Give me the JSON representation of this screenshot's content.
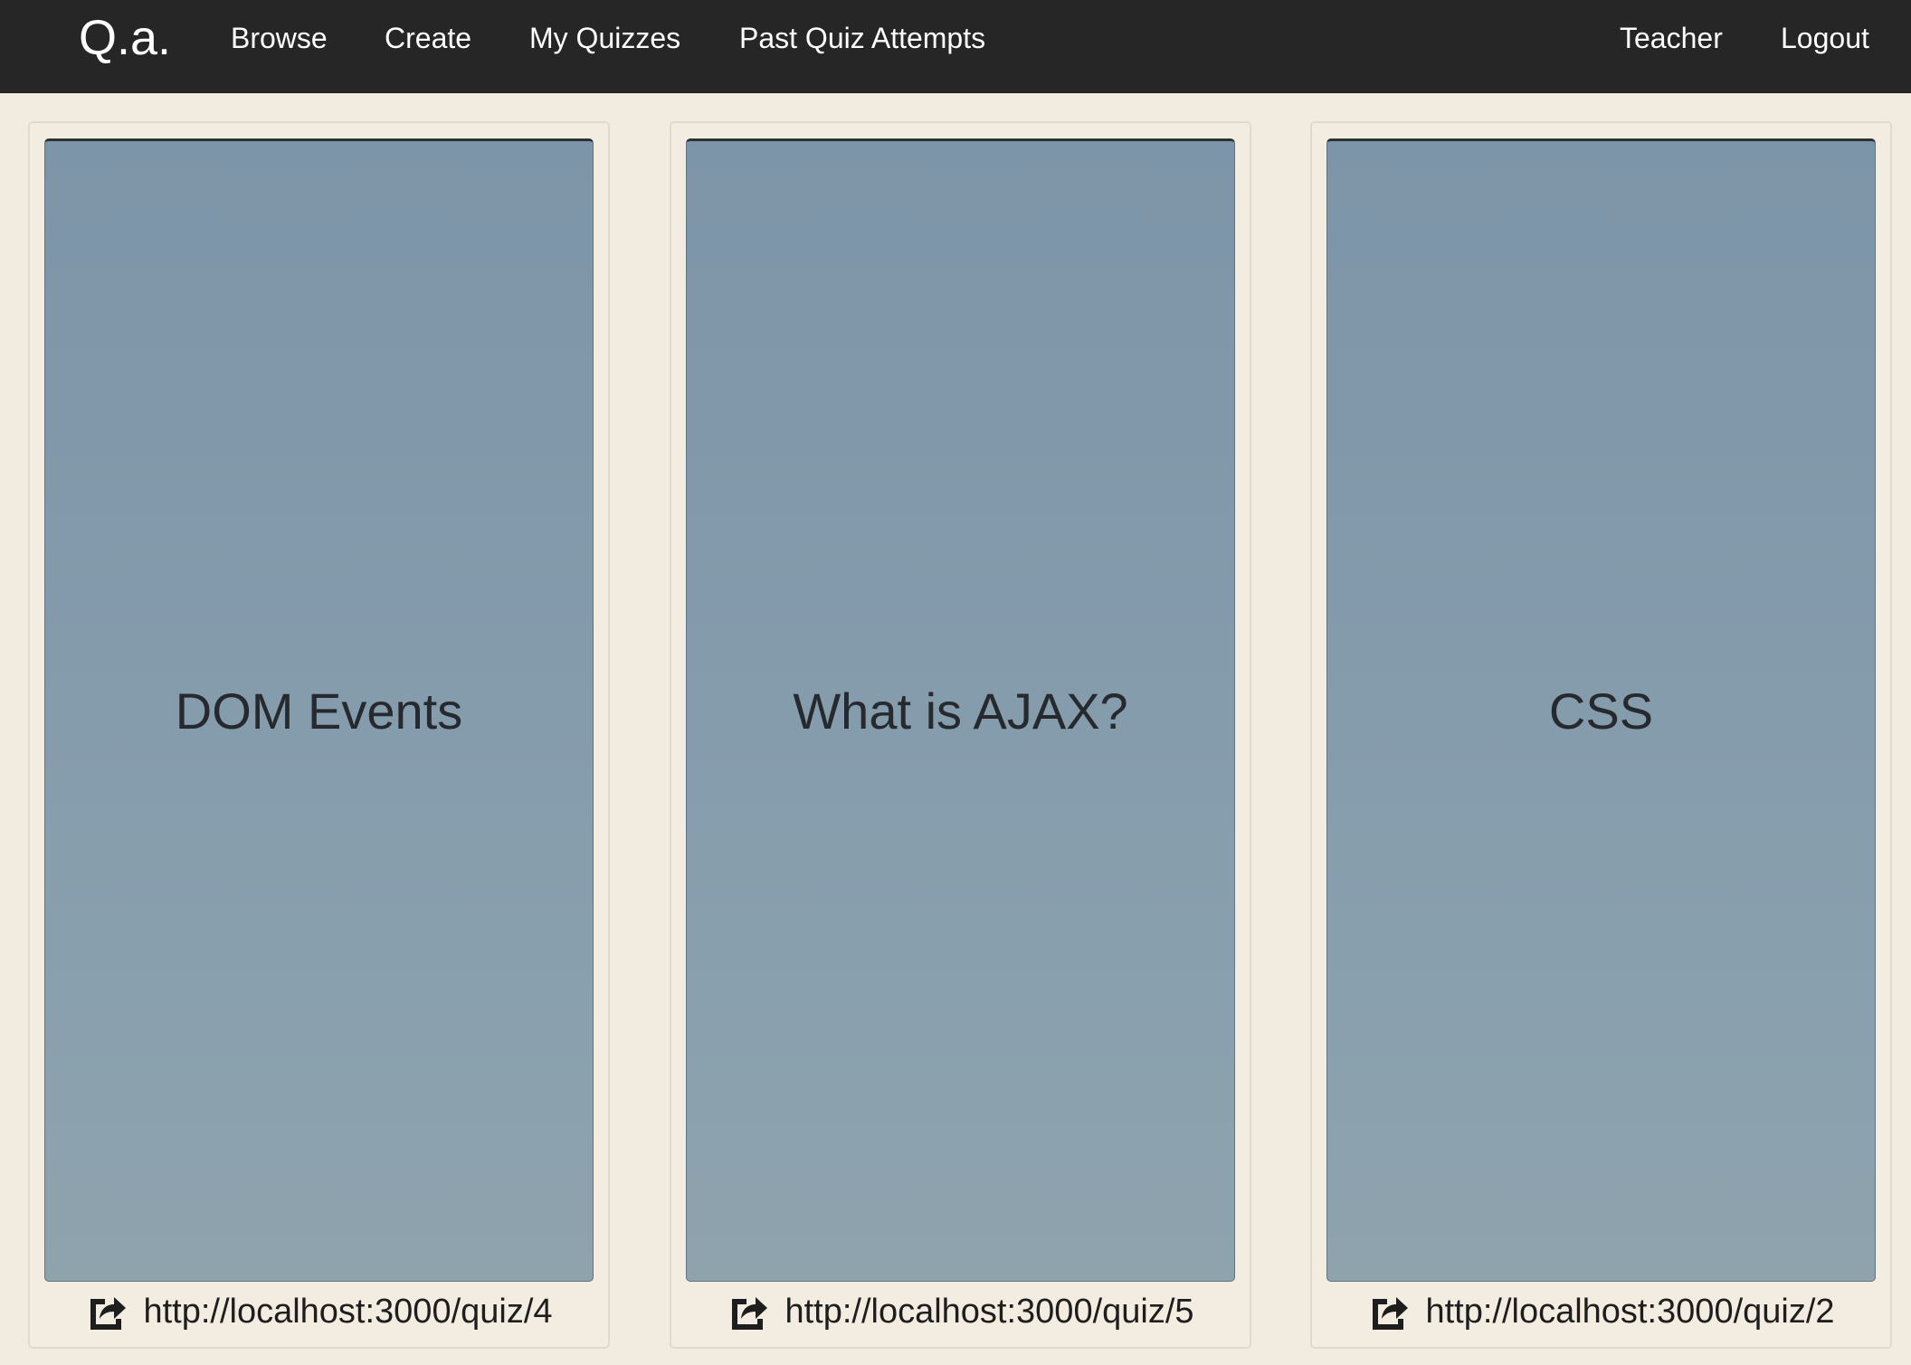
{
  "navbar": {
    "brand": "Q.a.",
    "links": [
      "Browse",
      "Create",
      "My Quizzes",
      "Past Quiz Attempts"
    ],
    "right_links": [
      "Teacher",
      "Logout"
    ]
  },
  "quizzes": [
    {
      "title": "DOM Events",
      "link": "http://localhost:3000/quiz/4",
      "icon": "share-icon"
    },
    {
      "title": "What is AJAX?",
      "link": "http://localhost:3000/quiz/5",
      "icon": "share-icon"
    },
    {
      "title": "CSS",
      "link": "http://localhost:3000/quiz/2",
      "icon": "share-icon"
    }
  ],
  "colors": {
    "navbar": "#262626",
    "background": "#f2ebdf",
    "card_image": "#849bac"
  }
}
